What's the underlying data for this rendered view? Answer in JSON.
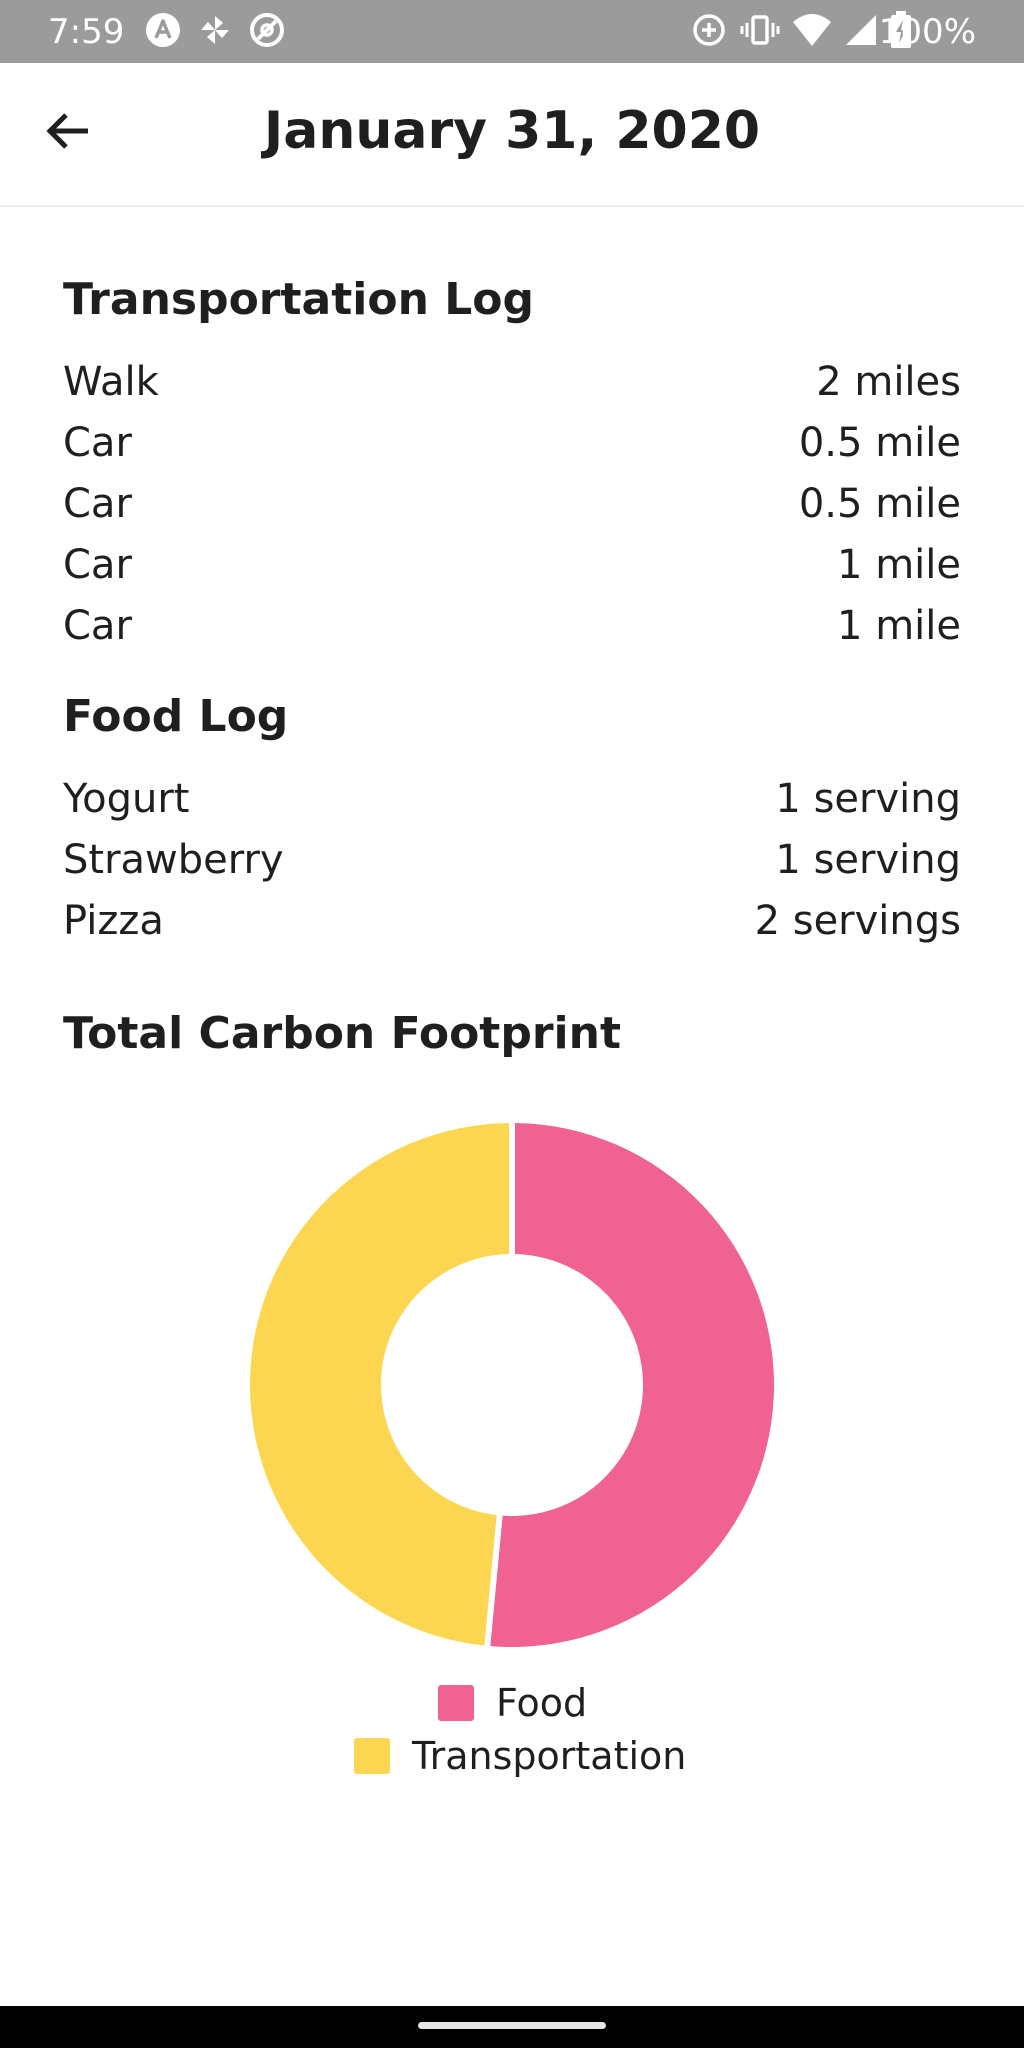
{
  "status_bar": {
    "time": "7:59",
    "battery": "100%",
    "left_icons": [
      "a-app-icon",
      "pinwheel-icon",
      "at-sync-icon"
    ],
    "right_icons": [
      "data-saver-icon",
      "vibrate-icon",
      "wifi-icon",
      "signal-icon",
      "battery-charging-icon"
    ]
  },
  "app_bar": {
    "title": "January 31, 2020",
    "back_icon": "arrow-left-icon"
  },
  "transportation": {
    "heading": "Transportation Log",
    "items": [
      {
        "label": "Walk",
        "value": "2 miles"
      },
      {
        "label": "Car",
        "value": "0.5 mile"
      },
      {
        "label": "Car",
        "value": "0.5 mile"
      },
      {
        "label": "Car",
        "value": "1 mile"
      },
      {
        "label": "Car",
        "value": "1 mile"
      }
    ]
  },
  "food": {
    "heading": "Food Log",
    "items": [
      {
        "label": "Yogurt",
        "value": "1 serving"
      },
      {
        "label": "Strawberry",
        "value": "1 serving"
      },
      {
        "label": "Pizza",
        "value": "2 servings"
      }
    ]
  },
  "total": {
    "heading": "Total Carbon Footprint"
  },
  "chart_data": {
    "type": "pie",
    "title": "",
    "donut": true,
    "categories": [
      "Food",
      "Transportation"
    ],
    "values": [
      51.5,
      48.5
    ],
    "colors": [
      "#f06292",
      "#fdd651"
    ],
    "legend": "bottom"
  }
}
